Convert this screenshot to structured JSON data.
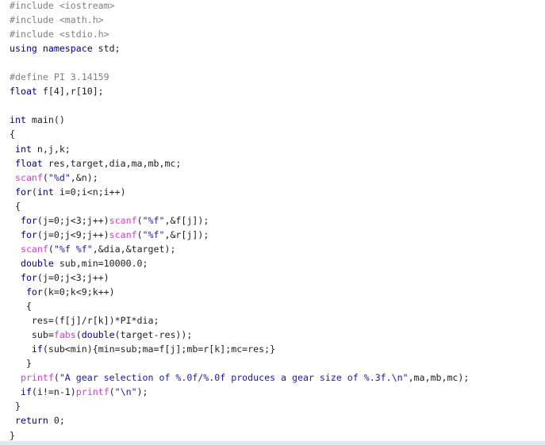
{
  "colors": {
    "preprocessor": "#808080",
    "keyword": "#00008b",
    "text": "#1e1e1e",
    "function": "#d13fd1",
    "string": "#1a1aa6",
    "background": "#ffffff",
    "bottom_bar": "#d9ecef"
  },
  "code": {
    "lines": [
      [
        {
          "t": "pp",
          "v": "#include <iostream>"
        }
      ],
      [
        {
          "t": "pp",
          "v": "#include <math.h>"
        }
      ],
      [
        {
          "t": "pp",
          "v": "#include <stdio.h>"
        }
      ],
      [
        {
          "t": "kw",
          "v": "using namespace"
        },
        {
          "t": "id",
          "v": " std;"
        }
      ],
      [],
      [
        {
          "t": "pp",
          "v": "#define PI 3.14159"
        }
      ],
      [
        {
          "t": "kw",
          "v": "float"
        },
        {
          "t": "id",
          "v": " f[4],r[10];"
        }
      ],
      [],
      [
        {
          "t": "kw",
          "v": "int"
        },
        {
          "t": "id",
          "v": " main()"
        }
      ],
      [
        {
          "t": "op",
          "v": "{"
        }
      ],
      [
        {
          "t": "kw",
          "v": " int"
        },
        {
          "t": "id",
          "v": " n,j,k;"
        }
      ],
      [
        {
          "t": "kw",
          "v": " float"
        },
        {
          "t": "id",
          "v": " res,target,dia,ma,mb,mc;"
        }
      ],
      [
        {
          "t": "fn",
          "v": " scanf"
        },
        {
          "t": "op",
          "v": "("
        },
        {
          "t": "str",
          "v": "\"%d\""
        },
        {
          "t": "op",
          "v": ",&n);"
        }
      ],
      [
        {
          "t": "kw",
          "v": " for"
        },
        {
          "t": "op",
          "v": "("
        },
        {
          "t": "kw",
          "v": "int"
        },
        {
          "t": "id",
          "v": " i=0;i<n;i++)"
        }
      ],
      [
        {
          "t": "op",
          "v": " {"
        }
      ],
      [
        {
          "t": "kw",
          "v": "  for"
        },
        {
          "t": "id",
          "v": "(j=0;j<3;j++)"
        },
        {
          "t": "fn",
          "v": "scanf"
        },
        {
          "t": "op",
          "v": "("
        },
        {
          "t": "str",
          "v": "\"%f\""
        },
        {
          "t": "op",
          "v": ",&f[j]);"
        }
      ],
      [
        {
          "t": "kw",
          "v": "  for"
        },
        {
          "t": "id",
          "v": "(j=0;j<9;j++)"
        },
        {
          "t": "fn",
          "v": "scanf"
        },
        {
          "t": "op",
          "v": "("
        },
        {
          "t": "str",
          "v": "\"%f\""
        },
        {
          "t": "op",
          "v": ",&r[j]);"
        }
      ],
      [
        {
          "t": "fn",
          "v": "  scanf"
        },
        {
          "t": "op",
          "v": "("
        },
        {
          "t": "str",
          "v": "\"%f %f\""
        },
        {
          "t": "op",
          "v": ",&dia,&target);"
        }
      ],
      [
        {
          "t": "kw",
          "v": "  double"
        },
        {
          "t": "id",
          "v": " sub,min=10000.0;"
        }
      ],
      [
        {
          "t": "kw",
          "v": "  for"
        },
        {
          "t": "id",
          "v": "(j=0;j<3;j++)"
        }
      ],
      [
        {
          "t": "kw",
          "v": "   for"
        },
        {
          "t": "id",
          "v": "(k=0;k<9;k++)"
        }
      ],
      [
        {
          "t": "op",
          "v": "   {"
        }
      ],
      [
        {
          "t": "id",
          "v": "    res=(f[j]/r[k])*PI*dia;"
        }
      ],
      [
        {
          "t": "id",
          "v": "    sub="
        },
        {
          "t": "fn",
          "v": "fabs"
        },
        {
          "t": "op",
          "v": "("
        },
        {
          "t": "kw",
          "v": "double"
        },
        {
          "t": "id",
          "v": "(target-res));"
        }
      ],
      [
        {
          "t": "kw",
          "v": "    if"
        },
        {
          "t": "id",
          "v": "(sub<min){min=sub;ma=f[j];mb=r[k];mc=res;}"
        }
      ],
      [
        {
          "t": "op",
          "v": "   }"
        }
      ],
      [
        {
          "t": "fn",
          "v": "  printf"
        },
        {
          "t": "op",
          "v": "("
        },
        {
          "t": "str",
          "v": "\"A gear selection of %.0f/%.0f produces a gear size of %.3f.\\n\""
        },
        {
          "t": "op",
          "v": ",ma,mb,mc);"
        }
      ],
      [
        {
          "t": "kw",
          "v": "  if"
        },
        {
          "t": "id",
          "v": "(i!=n-1)"
        },
        {
          "t": "fn",
          "v": "printf"
        },
        {
          "t": "op",
          "v": "("
        },
        {
          "t": "str",
          "v": "\"\\n\""
        },
        {
          "t": "op",
          "v": ");"
        }
      ],
      [
        {
          "t": "op",
          "v": " }"
        }
      ],
      [
        {
          "t": "kw",
          "v": " return"
        },
        {
          "t": "id",
          "v": " 0;"
        }
      ],
      [
        {
          "t": "op",
          "v": "}"
        }
      ]
    ]
  }
}
